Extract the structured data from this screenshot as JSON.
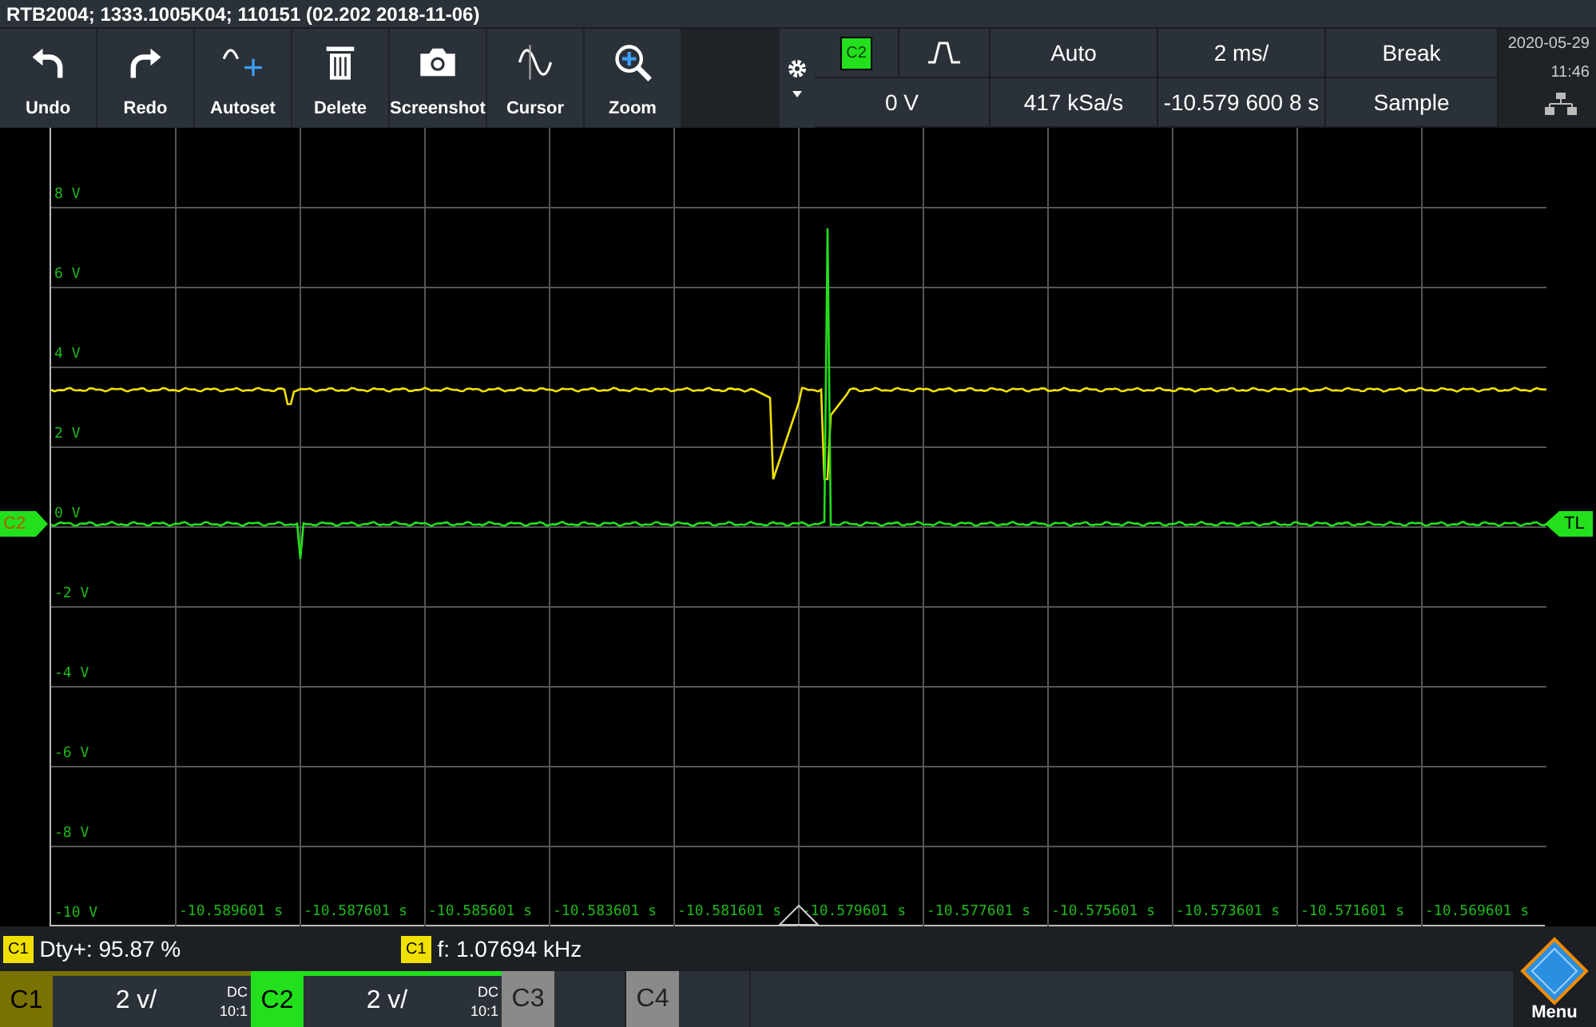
{
  "title": "RTB2004; 1333.1005K04; 110151 (02.202 2018-11-06)",
  "toolbar": [
    {
      "label": "Undo",
      "kind": "undo"
    },
    {
      "label": "Redo",
      "kind": "redo"
    },
    {
      "label": "Autoset",
      "kind": "autoset"
    },
    {
      "label": "Delete",
      "kind": "delete"
    },
    {
      "label": "Screenshot",
      "kind": "camera"
    },
    {
      "label": "Cursor",
      "kind": "cursor"
    },
    {
      "label": "Zoom",
      "kind": "zoom"
    }
  ],
  "trigger": {
    "source": "C2",
    "level": "0 V",
    "mode": "Auto",
    "sample_rate": "417 kSa/s",
    "timebase": "2 ms/",
    "position": "-10.579 600 8 s",
    "run_state": "Break",
    "acquisition": "Sample"
  },
  "date": "2020-05-29",
  "time": "11:46",
  "y_labels": [
    "8 V",
    "6 V",
    "4 V",
    "2 V",
    "0 V",
    "-2 V",
    "-4 V",
    "-6 V",
    "-8 V",
    "-10 V"
  ],
  "x_labels": [
    "-10.589601 s",
    "-10.587601 s",
    "-10.585601 s",
    "-10.583601 s",
    "-10.581601 s",
    "-10.579601 s",
    "-10.577601 s",
    "-10.575601 s",
    "-10.573601 s",
    "-10.571601 s",
    "-10.569601 s"
  ],
  "offset_marker": "C2",
  "trigger_marker": "TL",
  "measurements": [
    {
      "source": "C1",
      "text": "Dty+: 95.87 %"
    },
    {
      "source": "C1",
      "text": "f: 1.07694 kHz"
    }
  ],
  "channels": [
    {
      "name": "C1",
      "color": "#7a7200",
      "active": true,
      "scale": "2 v/",
      "coupling": "DC",
      "probe": "10:1"
    },
    {
      "name": "C2",
      "color": "#22e01c",
      "active": true,
      "scale": "2 v/",
      "coupling": "DC",
      "probe": "10:1"
    },
    {
      "name": "C3",
      "color": "#8a8a8a",
      "active": false
    },
    {
      "name": "C4",
      "color": "#8a8a8a",
      "active": false
    }
  ],
  "menu": "Menu"
}
